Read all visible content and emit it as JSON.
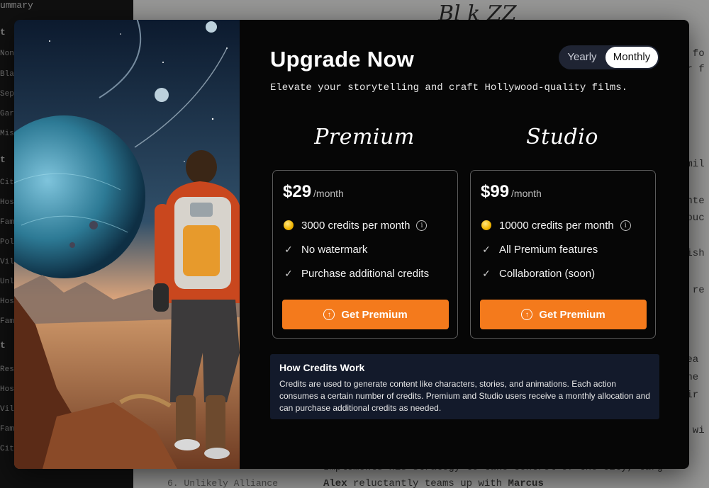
{
  "background": {
    "sidebar_title": "ummary",
    "sidebar_items": [
      "t",
      "Non",
      "Bla",
      "Sep",
      "Gar",
      "Mis",
      "t",
      "City",
      "Hos",
      "Fam",
      "Pol",
      "Vill",
      "Unl",
      "Hos",
      "Fam",
      "t",
      "Res",
      "Hos",
      "Vill",
      "Fam",
      "City"
    ],
    "doc_heading": "Bl   k  ZZ",
    "doc_lines": [
      "a fo",
      "er f",
      "amil",
      "inte",
      "rouc",
      "lish",
      "o re",
      "sea",
      "the",
      "fir",
      "t wi"
    ],
    "bottom_line_1": "Implements his strategy to take control of the city, targ",
    "bottom_item": "6. Unlikely Alliance",
    "bottom_line_2_bold_a": "Alex",
    "bottom_line_2": " reluctantly teams up with ",
    "bottom_line_2_bold_b": "Marcus"
  },
  "modal": {
    "title": "Upgrade Now",
    "subtitle": "Elevate your storytelling and craft Hollywood-quality films.",
    "toggle": {
      "yearly": "Yearly",
      "monthly": "Monthly",
      "selected": "Monthly"
    },
    "plans": [
      {
        "name": "Premium",
        "price": "$29",
        "period": "/month",
        "features": [
          "3000 credits per month",
          "No watermark",
          "Purchase additional credits"
        ],
        "cta": "Get Premium"
      },
      {
        "name": "Studio",
        "price": "$99",
        "period": "/month",
        "features": [
          "10000 credits per month",
          "All Premium features",
          "Collaboration (soon)"
        ],
        "cta": "Get Premium"
      }
    ],
    "how": {
      "title": "How Credits Work",
      "body": "Credits are used to generate content like characters, stories, and animations. Each action consumes a certain number of credits. Premium and Studio users receive a monthly allocation and can purchase additional credits as needed."
    },
    "icons": {
      "coin": "coin-icon",
      "check": "check-icon",
      "info": "info-icon",
      "upgrade": "arrow-up-circle-icon"
    },
    "colors": {
      "accent": "#f47a1c",
      "modal_bg": "#060606",
      "info_panel_bg": "#131a2b",
      "toggle_bg": "#1f2433"
    }
  }
}
